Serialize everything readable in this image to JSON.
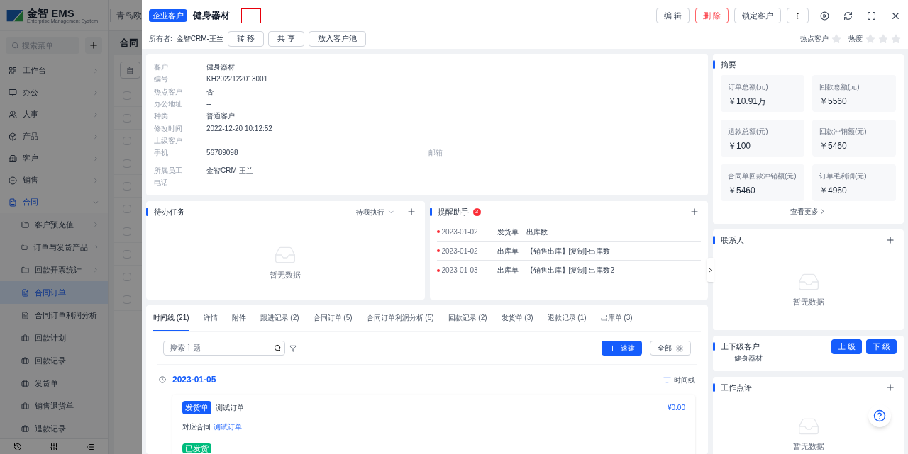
{
  "app": {
    "logo_text": "金智 EMS",
    "logo_subtitle": "Enterprise Management System",
    "company": "青岛欧",
    "search_placeholder": "搜索菜单",
    "page_title": "合同",
    "toolbar_button": "自",
    "rows": [
      {
        "checked": false
      },
      {
        "checked": false
      },
      {
        "checked": false
      },
      {
        "checked": false
      },
      {
        "checked": false
      },
      {
        "checked": false
      },
      {
        "checked": false
      },
      {
        "checked": false
      },
      {
        "checked": false
      },
      {
        "checked": false
      }
    ]
  },
  "sidebar": {
    "items": [
      {
        "label": "工作台",
        "expanded": false,
        "selected": false
      },
      {
        "label": "办公",
        "expanded": false,
        "selected": false
      },
      {
        "label": "人事",
        "expanded": false,
        "selected": false
      },
      {
        "label": "产品",
        "expanded": false,
        "selected": false
      },
      {
        "label": "客户",
        "expanded": false,
        "selected": false
      },
      {
        "label": "销售",
        "expanded": false,
        "selected": false
      },
      {
        "label": "合同",
        "expanded": true,
        "selected": true,
        "children": [
          {
            "label": "客户预充值",
            "kind": "folder",
            "selected": false
          },
          {
            "label": "订单与发货产品",
            "kind": "folder",
            "selected": false
          },
          {
            "label": "回款开票统计",
            "kind": "folder",
            "selected": false
          },
          {
            "label": "合同订单",
            "kind": "doc",
            "selected": true
          },
          {
            "label": "合同订单利润分析",
            "kind": "doc",
            "selected": false
          },
          {
            "label": "回款计划",
            "kind": "case",
            "selected": false
          },
          {
            "label": "回款记录",
            "kind": "case",
            "selected": false
          },
          {
            "label": "发货单",
            "kind": "case",
            "selected": false
          },
          {
            "label": "销售退货单",
            "kind": "case",
            "selected": false
          },
          {
            "label": "退款记录",
            "kind": "case",
            "selected": false
          }
        ]
      }
    ]
  },
  "drawer": {
    "tag": "企业客户",
    "title": "健身器材",
    "owner_label": "所有者:",
    "owner": "金智CRM-王兰",
    "owner_actions": [
      "转 移",
      "共 享",
      "放入客户池"
    ],
    "header_actions": [
      {
        "label": "编 辑",
        "kind": "default"
      },
      {
        "label": "删 除",
        "kind": "danger"
      },
      {
        "label": "锁定客户",
        "kind": "default"
      }
    ],
    "ratings": [
      {
        "label": "热点客户",
        "kind": "toggle",
        "on": false
      },
      {
        "label": "热度",
        "kind": "rating",
        "stars": 0
      }
    ]
  },
  "info_rows": [
    [
      {
        "label": "客户",
        "value": "健身器材"
      }
    ],
    [
      {
        "label": "编号",
        "value": "KH2022122013001"
      }
    ],
    [
      {
        "label": "热点客户",
        "value": "否"
      }
    ],
    [
      {
        "label": "办公地址",
        "value": "--"
      }
    ],
    [
      {
        "label": "种类",
        "value": "普通客户"
      }
    ],
    [
      {
        "label": "修改时间",
        "value": "2022-12-20 10:12:52"
      }
    ],
    [
      {
        "label": "上级客户"
      }
    ],
    [
      {
        "label": "手机",
        "value": "56789098"
      },
      {
        "label": "邮箱"
      }
    ],
    [
      {
        "label": "所属员工",
        "value": "金智CRM-王兰"
      }
    ],
    [
      {
        "label": "电话"
      }
    ]
  ],
  "todo": {
    "title": "待办任务",
    "filter": "待我执行",
    "empty": "暂无数据"
  },
  "reminders": {
    "title": "提醒助手",
    "count": "3",
    "items": [
      {
        "date": "2023-01-02",
        "type": "发货单",
        "text": "出库数"
      },
      {
        "date": "2023-01-02",
        "type": "出库单",
        "text": "【销售出库】[复制]-出库数"
      },
      {
        "date": "2023-01-03",
        "type": "出库单",
        "text": "【销售出库】[复制]-出库数2"
      }
    ]
  },
  "tabs": [
    {
      "label": "时间线 (21)",
      "selected": true
    },
    {
      "label": "详情",
      "selected": false
    },
    {
      "label": "附件",
      "selected": false
    },
    {
      "label": "跟进记录 (2)",
      "selected": false
    },
    {
      "label": "合同订单 (5)",
      "selected": false
    },
    {
      "label": "合同订单利润分析 (5)",
      "selected": false
    },
    {
      "label": "回款记录 (2)",
      "selected": false
    },
    {
      "label": "发货单 (3)",
      "selected": false
    },
    {
      "label": "退款记录 (1)",
      "selected": false
    },
    {
      "label": "出库单 (3)",
      "selected": false
    }
  ],
  "timeline": {
    "search_placeholder": "搜索主题",
    "quick_add": "速建",
    "all": "全部",
    "view": "时间线",
    "date": "2023-01-05",
    "entries": [
      {
        "tag": "发货单",
        "title": "测试订单",
        "amount": "¥0.00",
        "contract_label": "对应合同",
        "contract_link": "测试订单",
        "status": "已发货"
      }
    ]
  },
  "summary": {
    "title": "摘要",
    "stats": [
      {
        "label": "订单总额(元)",
        "value": "￥10.91万"
      },
      {
        "label": "回款总额(元)",
        "value": "￥5560"
      },
      {
        "label": "退款总额(元)",
        "value": "￥100"
      },
      {
        "label": "回款冲销额(元)",
        "value": "￥5460"
      },
      {
        "label": "合同单回款冲销额(元)",
        "value": "￥5460"
      },
      {
        "label": "订单毛利润(元)",
        "value": "￥4960"
      }
    ],
    "more": "查看更多"
  },
  "contacts": {
    "title": "联系人",
    "empty": "暂无数据"
  },
  "related": {
    "title": "上下级客户",
    "buttons": [
      "上 级",
      "下 级"
    ],
    "items": [
      "健身器材"
    ]
  },
  "reviews": {
    "title": "工作点评",
    "empty": "暂无数据"
  }
}
